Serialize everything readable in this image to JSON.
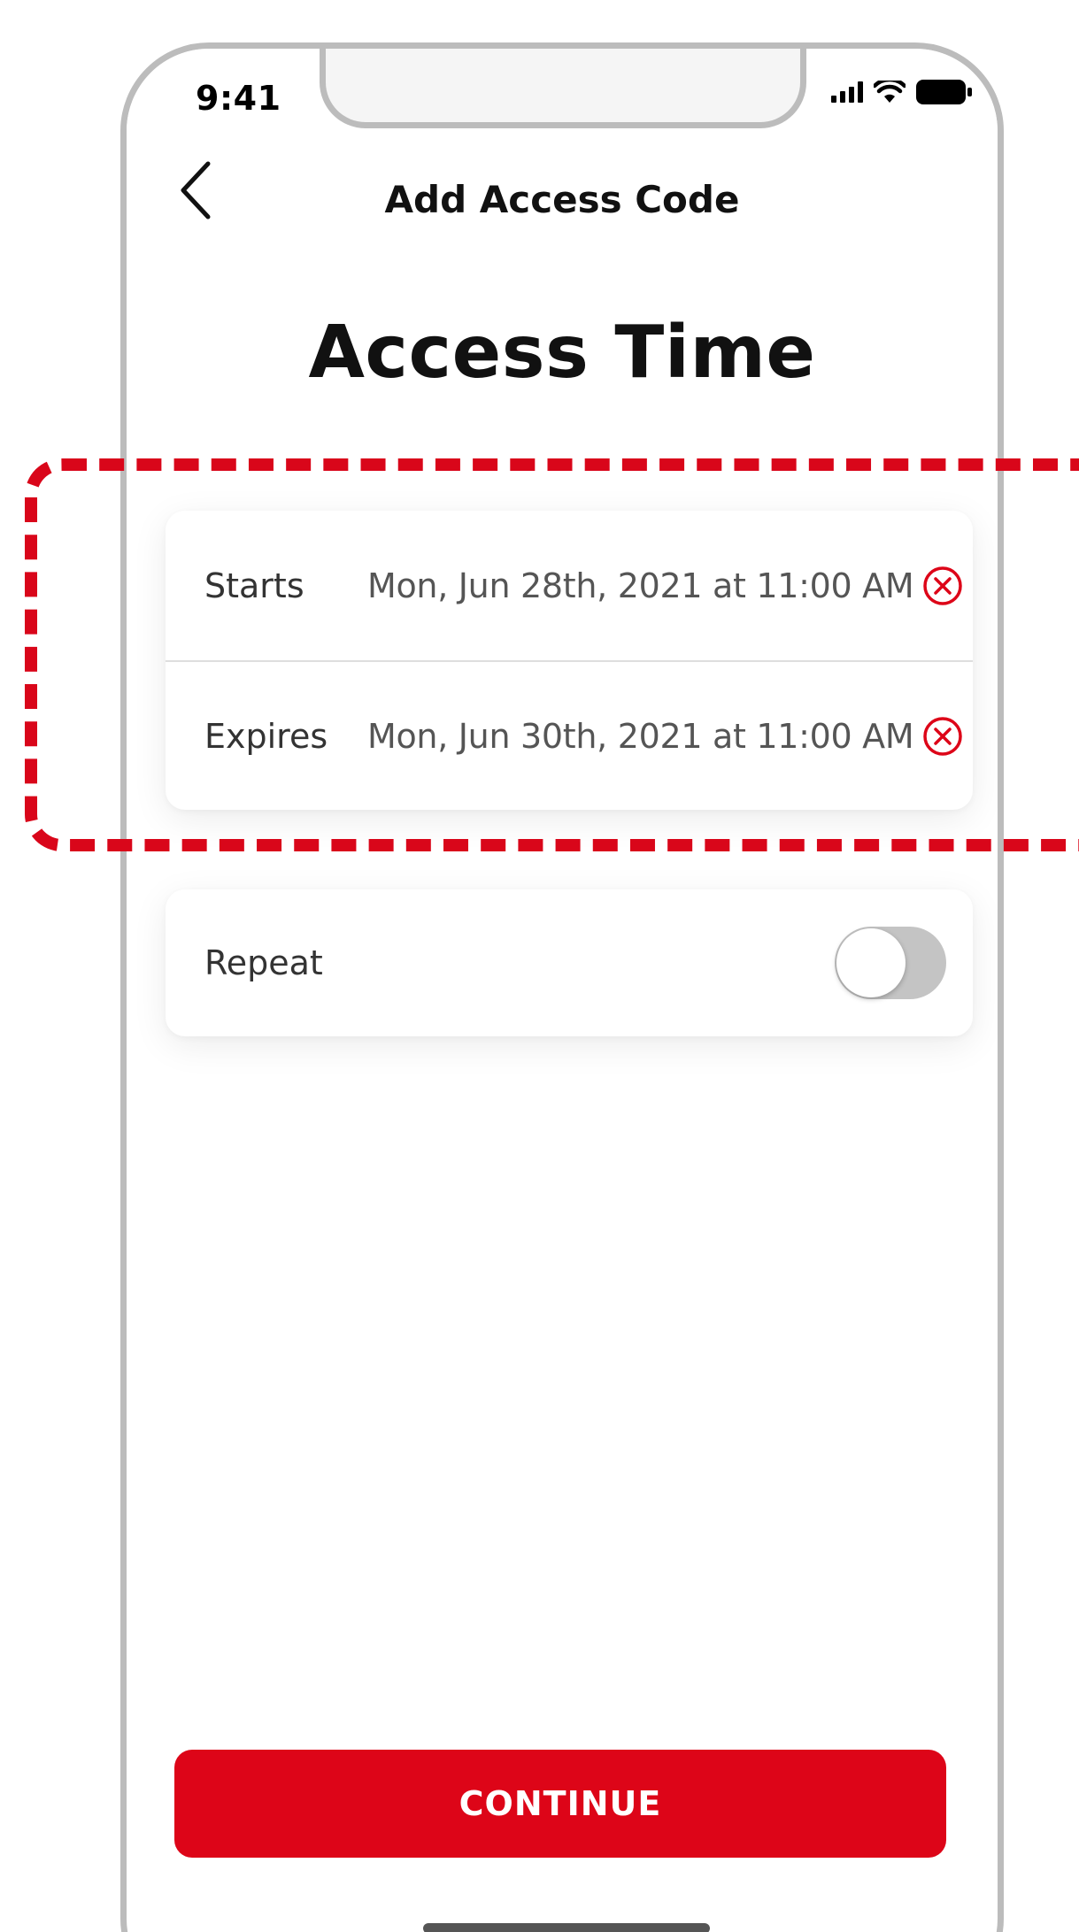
{
  "status_bar": {
    "time": "9:41"
  },
  "header": {
    "title": "Add Access Code"
  },
  "page": {
    "title": "Access Time"
  },
  "access_time": {
    "rows": [
      {
        "label": "Starts",
        "value": "Mon, Jun 28th, 2021 at 11:00 AM"
      },
      {
        "label": "Expires",
        "value": "Mon, Jun 30th, 2021 at 11:00 AM"
      }
    ]
  },
  "repeat": {
    "label": "Repeat",
    "enabled": false
  },
  "footer": {
    "continue_label": "CONTINUE"
  },
  "colors": {
    "accent": "#dd0518",
    "toggle_off": "#c4c4c4",
    "frame": "#bcbcbc"
  },
  "icons": {
    "back": "chevron-left-icon",
    "clear": "clear-circle-x-icon",
    "signal": "cellular-signal-icon",
    "wifi": "wifi-icon",
    "battery": "battery-icon"
  }
}
